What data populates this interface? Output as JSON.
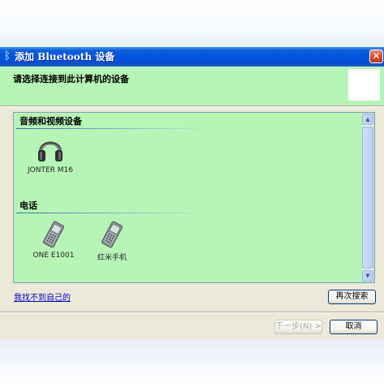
{
  "window": {
    "title": "添加 Bluetooth 设备",
    "title_icon": "bluetooth-icon",
    "close_glyph": "✕"
  },
  "header": {
    "instruction": "请选择连接到此计算机的设备"
  },
  "groups": [
    {
      "label": "音频和视频设备",
      "devices": [
        {
          "name": "JONTER M16",
          "icon": "headphones-icon"
        }
      ]
    },
    {
      "label": "电话",
      "devices": [
        {
          "name": "ONE E1001",
          "icon": "mobile-phone-icon"
        },
        {
          "name": "红米手机",
          "icon": "mobile-phone-icon"
        }
      ]
    }
  ],
  "links": {
    "cant_find": "我找不到自己的"
  },
  "buttons": {
    "search_again": "再次搜索",
    "next": "下一步(N) >",
    "cancel": "取消"
  },
  "colors": {
    "header_bg": "#b6f5b6",
    "list_bg": "#b6f5b6",
    "titlebar": "#0054e3",
    "dialog_bg": "#ece9d8"
  }
}
